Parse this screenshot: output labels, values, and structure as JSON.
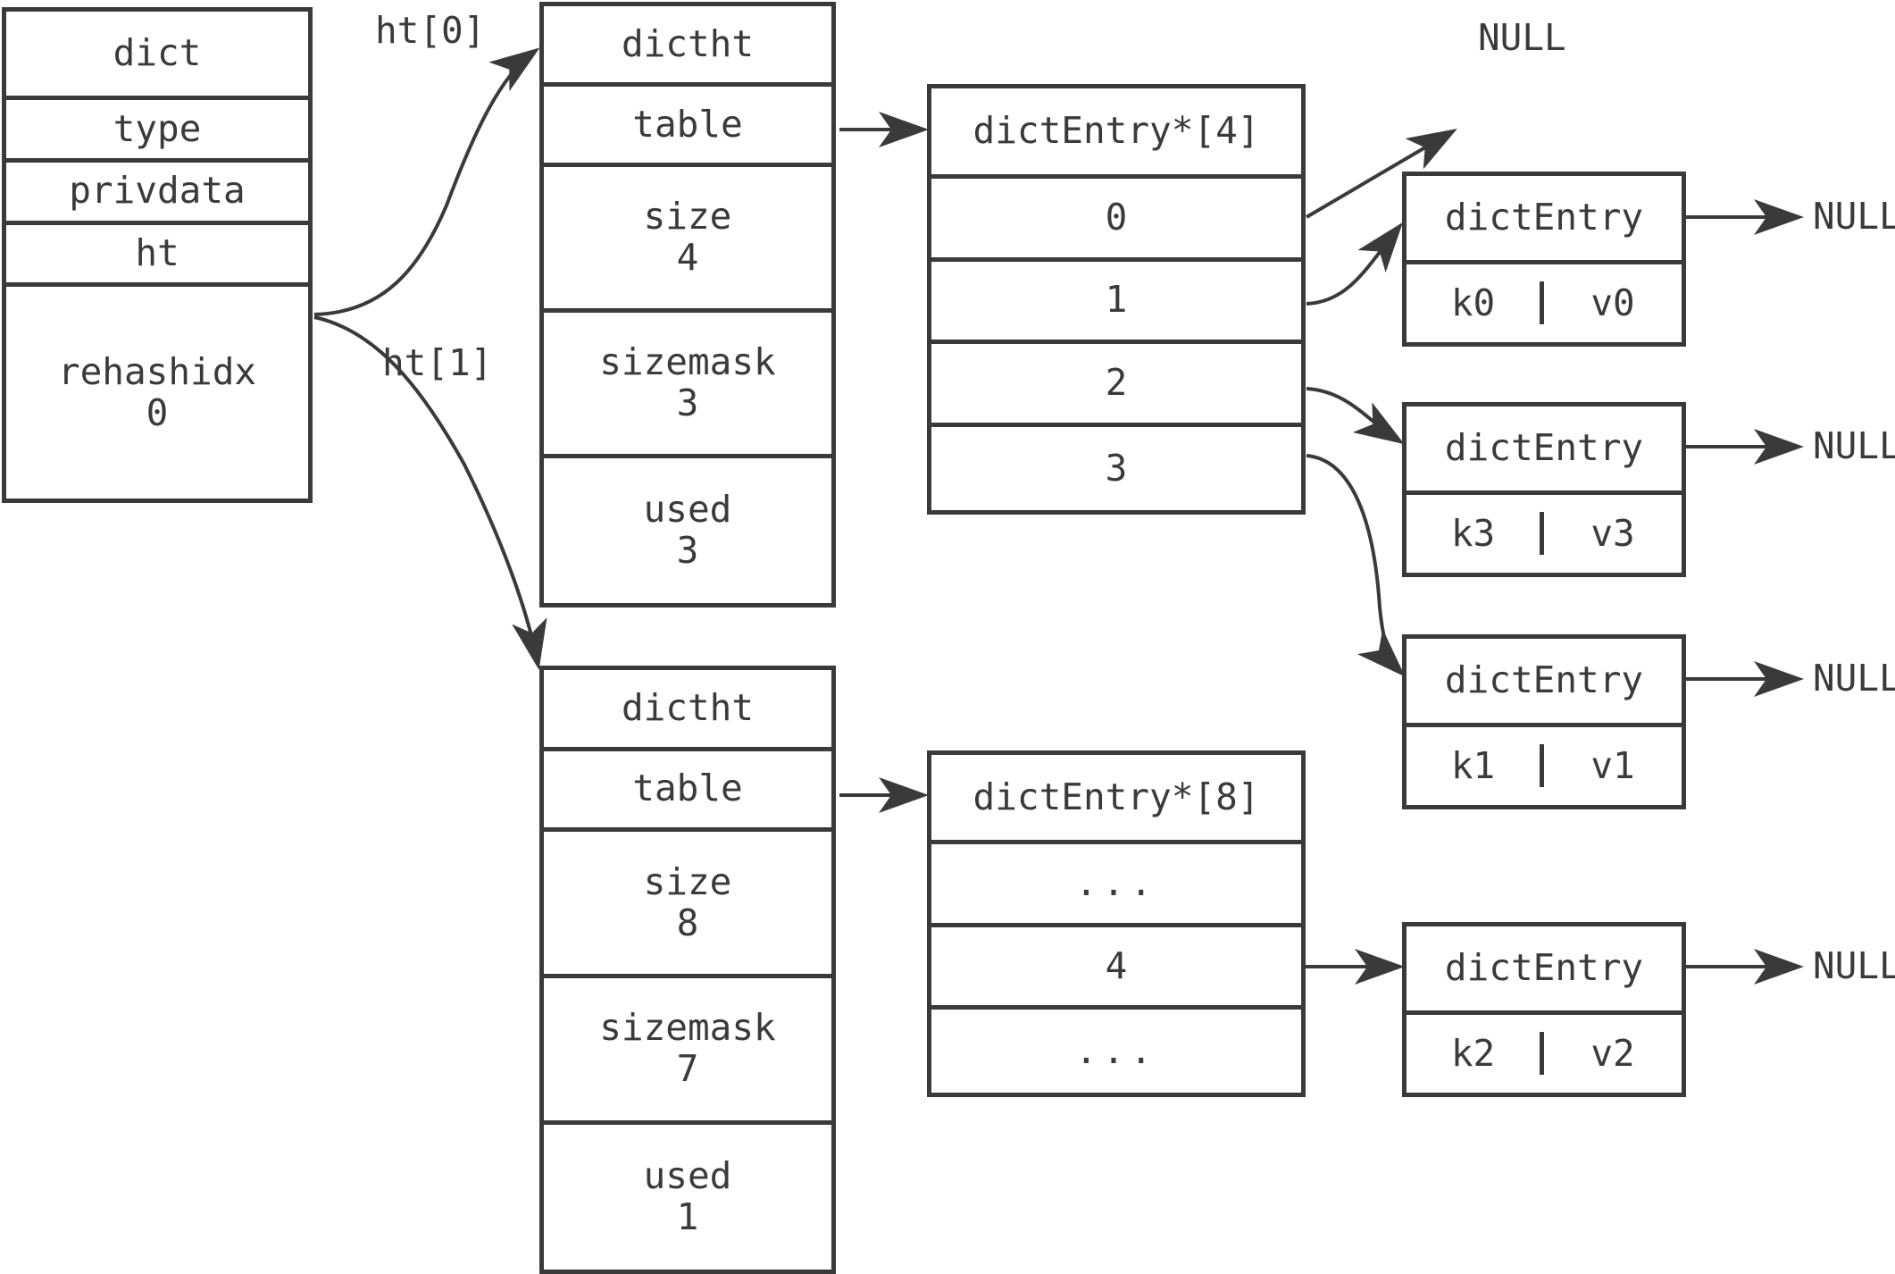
{
  "diagram": {
    "title_struct": "dict",
    "colors": {
      "stroke": "#3a3a3a",
      "background": "#ffffff"
    }
  },
  "dict_box": {
    "header": "dict",
    "fields": [
      {
        "name": "type",
        "value": ""
      },
      {
        "name": "privdata",
        "value": ""
      },
      {
        "name": "ht",
        "value": ""
      },
      {
        "name": "rehashidx",
        "value": "0"
      }
    ]
  },
  "pointer_labels": {
    "ht0": "ht[0]",
    "ht1": "ht[1]"
  },
  "dictht0": {
    "header": "dictht",
    "table_label": "table",
    "size_label": "size",
    "size_value": "4",
    "sizemask_label": "sizemask",
    "sizemask_value": "3",
    "used_label": "used",
    "used_value": "3"
  },
  "dictht1": {
    "header": "dictht",
    "table_label": "table",
    "size_label": "size",
    "size_value": "8",
    "sizemask_label": "sizemask",
    "sizemask_value": "7",
    "used_label": "used",
    "used_value": "1"
  },
  "table0": {
    "header": "dictEntry*[4]",
    "slots": [
      "0",
      "1",
      "2",
      "3"
    ]
  },
  "table1": {
    "header": "dictEntry*[8]",
    "slots": [
      "...",
      "4",
      "..."
    ]
  },
  "entries": [
    {
      "header": "dictEntry",
      "key": "k0",
      "value": "v0",
      "next": "NULL"
    },
    {
      "header": "dictEntry",
      "key": "k3",
      "value": "v3",
      "next": "NULL"
    },
    {
      "header": "dictEntry",
      "key": "k1",
      "value": "v1",
      "next": "NULL"
    },
    {
      "header": "dictEntry",
      "key": "k2",
      "value": "v2",
      "next": "NULL"
    }
  ],
  "null_labels": {
    "slot0_null": "NULL",
    "entry0_null": "NULL",
    "entry1_null": "NULL",
    "entry2_null": "NULL",
    "entry3_null": "NULL"
  }
}
